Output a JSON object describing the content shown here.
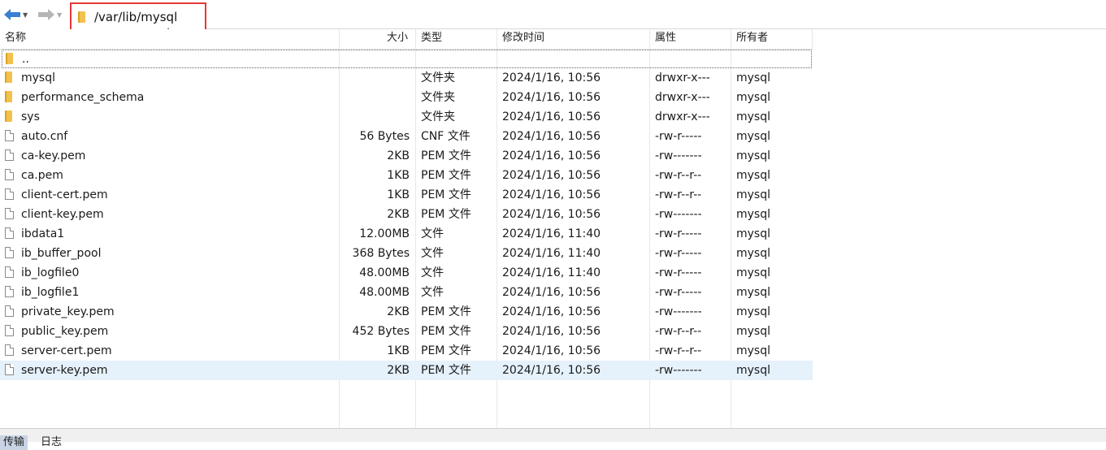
{
  "address": {
    "path": "/var/lib/mysql"
  },
  "columns": {
    "name": "名称",
    "size": "大小",
    "type": "类型",
    "modified": "修改时间",
    "permissions": "属性",
    "owner": "所有者"
  },
  "parent": {
    "name": ".."
  },
  "files": [
    {
      "name": "mysql",
      "size": "",
      "type": "文件夹",
      "modified": "2024/1/16, 10:56",
      "permissions": "drwxr-x---",
      "owner": "mysql",
      "icon": "folder-icon"
    },
    {
      "name": "performance_schema",
      "size": "",
      "type": "文件夹",
      "modified": "2024/1/16, 10:56",
      "permissions": "drwxr-x---",
      "owner": "mysql",
      "icon": "folder-icon"
    },
    {
      "name": "sys",
      "size": "",
      "type": "文件夹",
      "modified": "2024/1/16, 10:56",
      "permissions": "drwxr-x---",
      "owner": "mysql",
      "icon": "folder-icon"
    },
    {
      "name": "auto.cnf",
      "size": "56 Bytes",
      "type": "CNF 文件",
      "modified": "2024/1/16, 10:56",
      "permissions": "-rw-r-----",
      "owner": "mysql",
      "icon": "file-icon"
    },
    {
      "name": "ca-key.pem",
      "size": "2KB",
      "type": "PEM 文件",
      "modified": "2024/1/16, 10:56",
      "permissions": "-rw-------",
      "owner": "mysql",
      "icon": "file-icon"
    },
    {
      "name": "ca.pem",
      "size": "1KB",
      "type": "PEM 文件",
      "modified": "2024/1/16, 10:56",
      "permissions": "-rw-r--r--",
      "owner": "mysql",
      "icon": "file-icon"
    },
    {
      "name": "client-cert.pem",
      "size": "1KB",
      "type": "PEM 文件",
      "modified": "2024/1/16, 10:56",
      "permissions": "-rw-r--r--",
      "owner": "mysql",
      "icon": "file-icon"
    },
    {
      "name": "client-key.pem",
      "size": "2KB",
      "type": "PEM 文件",
      "modified": "2024/1/16, 10:56",
      "permissions": "-rw-------",
      "owner": "mysql",
      "icon": "file-icon"
    },
    {
      "name": "ibdata1",
      "size": "12.00MB",
      "type": "文件",
      "modified": "2024/1/16, 11:40",
      "permissions": "-rw-r-----",
      "owner": "mysql",
      "icon": "file-icon"
    },
    {
      "name": "ib_buffer_pool",
      "size": "368 Bytes",
      "type": "文件",
      "modified": "2024/1/16, 11:40",
      "permissions": "-rw-r-----",
      "owner": "mysql",
      "icon": "file-icon"
    },
    {
      "name": "ib_logfile0",
      "size": "48.00MB",
      "type": "文件",
      "modified": "2024/1/16, 11:40",
      "permissions": "-rw-r-----",
      "owner": "mysql",
      "icon": "file-icon"
    },
    {
      "name": "ib_logfile1",
      "size": "48.00MB",
      "type": "文件",
      "modified": "2024/1/16, 10:56",
      "permissions": "-rw-r-----",
      "owner": "mysql",
      "icon": "file-icon"
    },
    {
      "name": "private_key.pem",
      "size": "2KB",
      "type": "PEM 文件",
      "modified": "2024/1/16, 10:56",
      "permissions": "-rw-------",
      "owner": "mysql",
      "icon": "file-icon"
    },
    {
      "name": "public_key.pem",
      "size": "452 Bytes",
      "type": "PEM 文件",
      "modified": "2024/1/16, 10:56",
      "permissions": "-rw-r--r--",
      "owner": "mysql",
      "icon": "file-icon"
    },
    {
      "name": "server-cert.pem",
      "size": "1KB",
      "type": "PEM 文件",
      "modified": "2024/1/16, 10:56",
      "permissions": "-rw-r--r--",
      "owner": "mysql",
      "icon": "file-icon"
    },
    {
      "name": "server-key.pem",
      "size": "2KB",
      "type": "PEM 文件",
      "modified": "2024/1/16, 10:56",
      "permissions": "-rw-------",
      "owner": "mysql",
      "icon": "file-icon",
      "selected": true
    }
  ],
  "bottom_tabs": {
    "active": "传输",
    "second": "日志"
  },
  "colors": {
    "selected_row": "#e5f1fb",
    "highlight_border": "#e53935",
    "nav_arrow": "#3b7fd4"
  }
}
